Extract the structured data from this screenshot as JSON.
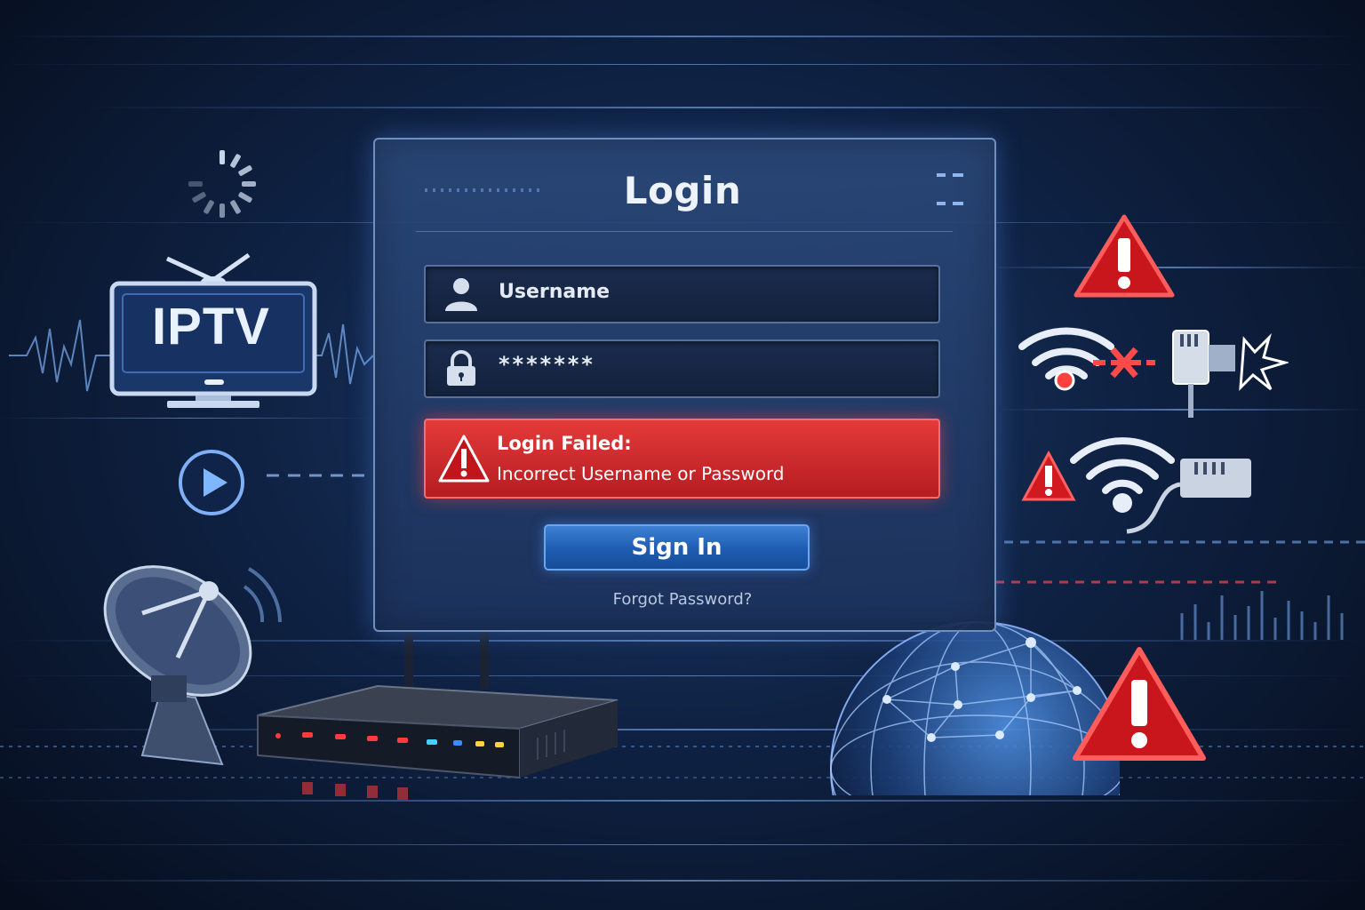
{
  "login": {
    "title": "Login",
    "username_placeholder": "Username",
    "password_masked": "*******",
    "error_title": "Login Failed:",
    "error_message": "Incorrect Username or Password",
    "sign_in_label": "Sign In",
    "forgot_password_label": "Forgot Password?"
  },
  "tv": {
    "label": "IPTV"
  },
  "icons": {
    "loading": "loading-spinner-icon",
    "tv": "tv-icon",
    "play": "play-icon",
    "satellite": "satellite-dish-icon",
    "router": "router-icon",
    "globe": "globe-network-icon",
    "warning": "warning-icon",
    "wifi": "wifi-icon",
    "ethernet": "ethernet-plug-icon",
    "user": "user-icon",
    "lock": "lock-icon"
  },
  "colors": {
    "accent_blue": "#2a6bc7",
    "error_red": "#d12a2e",
    "panel_bg": "#223f6e",
    "background": "#0a1630"
  }
}
